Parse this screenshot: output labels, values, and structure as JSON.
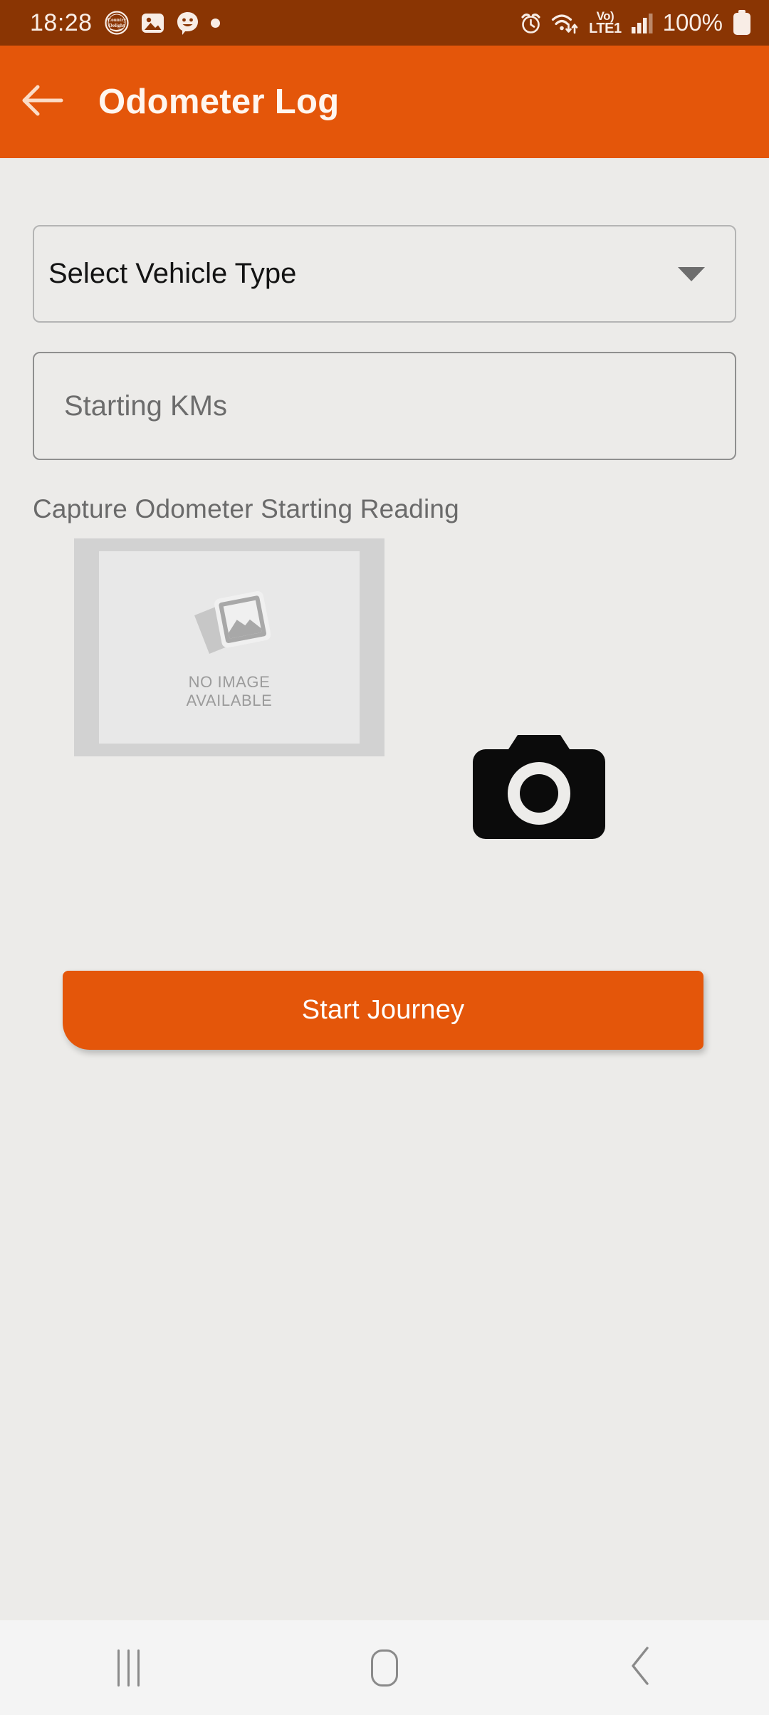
{
  "status_bar": {
    "time": "18:28",
    "battery_percent": "100%",
    "volte_top": "Vo)",
    "volte_bottom": "LTE1",
    "left_icons": [
      "country-delight-app-icon",
      "gallery-notification-icon",
      "chat-smiley-notification-icon",
      "notification-dot-icon"
    ],
    "right_icons": [
      "alarm-icon",
      "wifi-data-transfer-icon",
      "volte-indicator",
      "cellular-signal-icon",
      "battery-icon"
    ],
    "background_color": "#8A3503",
    "foreground_color": "#F8EDE6"
  },
  "app_bar": {
    "title": "Odometer Log",
    "back_icon": "arrow-left-icon",
    "background_color": "#E4560A",
    "text_color": "#FFF6EF"
  },
  "form": {
    "vehicle_type": {
      "label": "Select Vehicle Type",
      "selected_value": "Select Vehicle Type",
      "dropdown_icon": "chevron-down-icon"
    },
    "starting_kms": {
      "placeholder": "Starting KMs",
      "value": ""
    },
    "capture_section": {
      "label": "Capture Odometer Starting Reading",
      "placeholder_line1": "NO IMAGE",
      "placeholder_line2": "AVAILABLE",
      "placeholder_icon": "image-placeholder-icon",
      "camera_icon": "camera-icon"
    },
    "primary_action": {
      "label": "Start Journey",
      "background_color": "#E4560A",
      "text_color": "#FFFFFF"
    }
  },
  "nav_bar": {
    "recents_icon": "recents-icon",
    "home_icon": "home-icon",
    "back_icon": "back-chevron-icon",
    "background_color": "#F4F4F4"
  },
  "page": {
    "background_color": "#ECEBE9"
  }
}
